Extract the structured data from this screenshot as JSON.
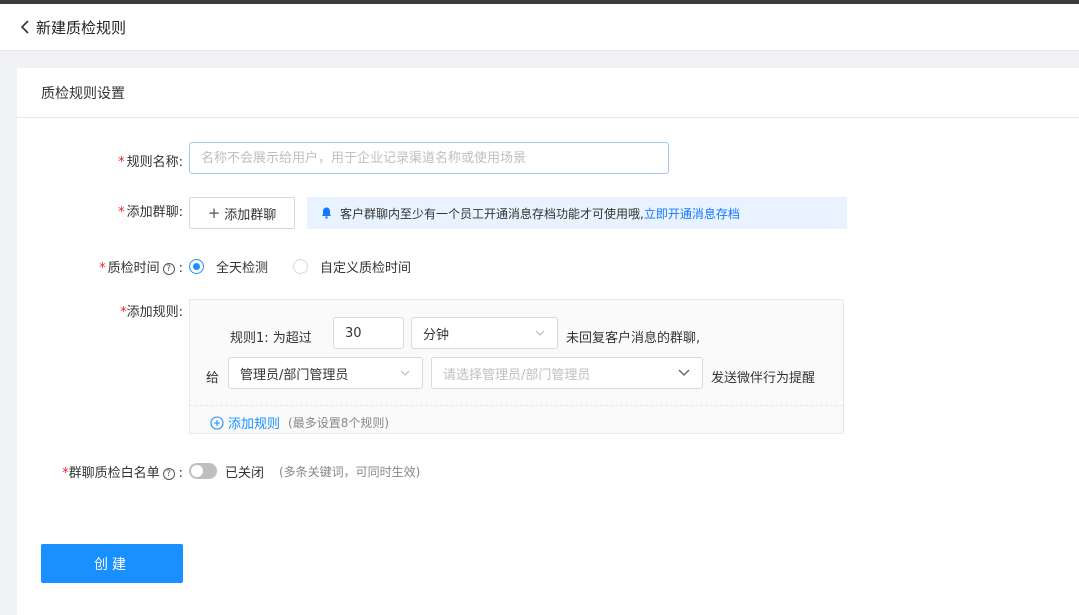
{
  "header": {
    "title": "新建质检规则"
  },
  "section": {
    "title": "质检规则设置"
  },
  "form": {
    "name": {
      "required": "*",
      "label": "规则名称:",
      "placeholder": "名称不会展示给用户，用于企业记录渠道名称或使用场景",
      "value": ""
    },
    "group": {
      "required": "*",
      "label": "添加群聊:",
      "button": "添加群聊",
      "notice": "客户群聊内至少有一个员工开通消息存档功能才可使用哦,",
      "notice_link": "立即开通消息存档"
    },
    "time": {
      "required": "*",
      "label": "质检时间",
      "colon": ":",
      "options": [
        {
          "label": "全天检测",
          "checked": true
        },
        {
          "label": "自定义质检时间",
          "checked": false
        }
      ]
    },
    "rules": {
      "required": "*",
      "label": "添加规则:",
      "rule1_prefix": "规则1: 为超过",
      "minutes_value": "30",
      "unit_value": "分钟",
      "rule1_suffix": "未回复客户消息的群聊,",
      "give_label": "给",
      "role_value": "管理员/部门管理员",
      "manager_placeholder": "请选择管理员/部门管理员",
      "remind_text": "发送微伴行为提醒",
      "add_rule_label": "添加规则",
      "add_rule_hint": "(最多设置8个规则)"
    },
    "whitelist": {
      "required": "*",
      "label": "群聊质检白名单",
      "colon": ":",
      "toggle_state": "已关闭",
      "enabled": false,
      "hint": "(多条关键词，可同时生效)"
    }
  },
  "actions": {
    "create": "创建"
  },
  "colors": {
    "primary": "#1890ff",
    "required": "#f5222d",
    "notice_bg": "#e8f3ff"
  }
}
